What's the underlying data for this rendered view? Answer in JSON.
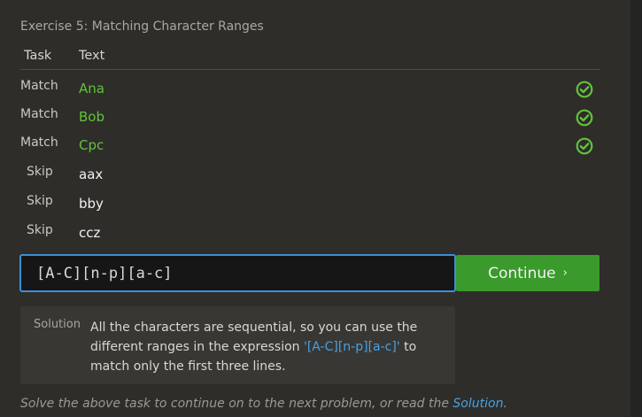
{
  "exercise": {
    "title": "Exercise 5: Matching Character Ranges"
  },
  "table": {
    "headers": {
      "task": "Task",
      "text": "Text"
    },
    "rows": [
      {
        "task": "Match",
        "text": "Ana",
        "status": "passed"
      },
      {
        "task": "Match",
        "text": "Bob",
        "status": "passed"
      },
      {
        "task": "Match",
        "text": "Cpc",
        "status": "passed"
      },
      {
        "task": "Skip",
        "text": "aax",
        "status": ""
      },
      {
        "task": "Skip",
        "text": "bby",
        "status": ""
      },
      {
        "task": "Skip",
        "text": "ccz",
        "status": ""
      }
    ]
  },
  "input": {
    "value": "[A-C][n-p][a-c]"
  },
  "continue_button": {
    "label": "Continue",
    "chevron": "›"
  },
  "solution": {
    "label": "Solution",
    "text_before": "All the characters are sequential, so you can use the different ranges in the expression ",
    "code": "'[A-C][n-p][a-c]'",
    "text_after": " to match only the first three lines."
  },
  "footer": {
    "text": "Solve the above task to continue on to the next problem, or read the ",
    "link": "Solution",
    "end": "."
  },
  "colors": {
    "success": "#62c23d",
    "accent": "#4aa0e0",
    "button": "#3a9a2c"
  },
  "icons": {
    "status": "check-circle-icon"
  }
}
